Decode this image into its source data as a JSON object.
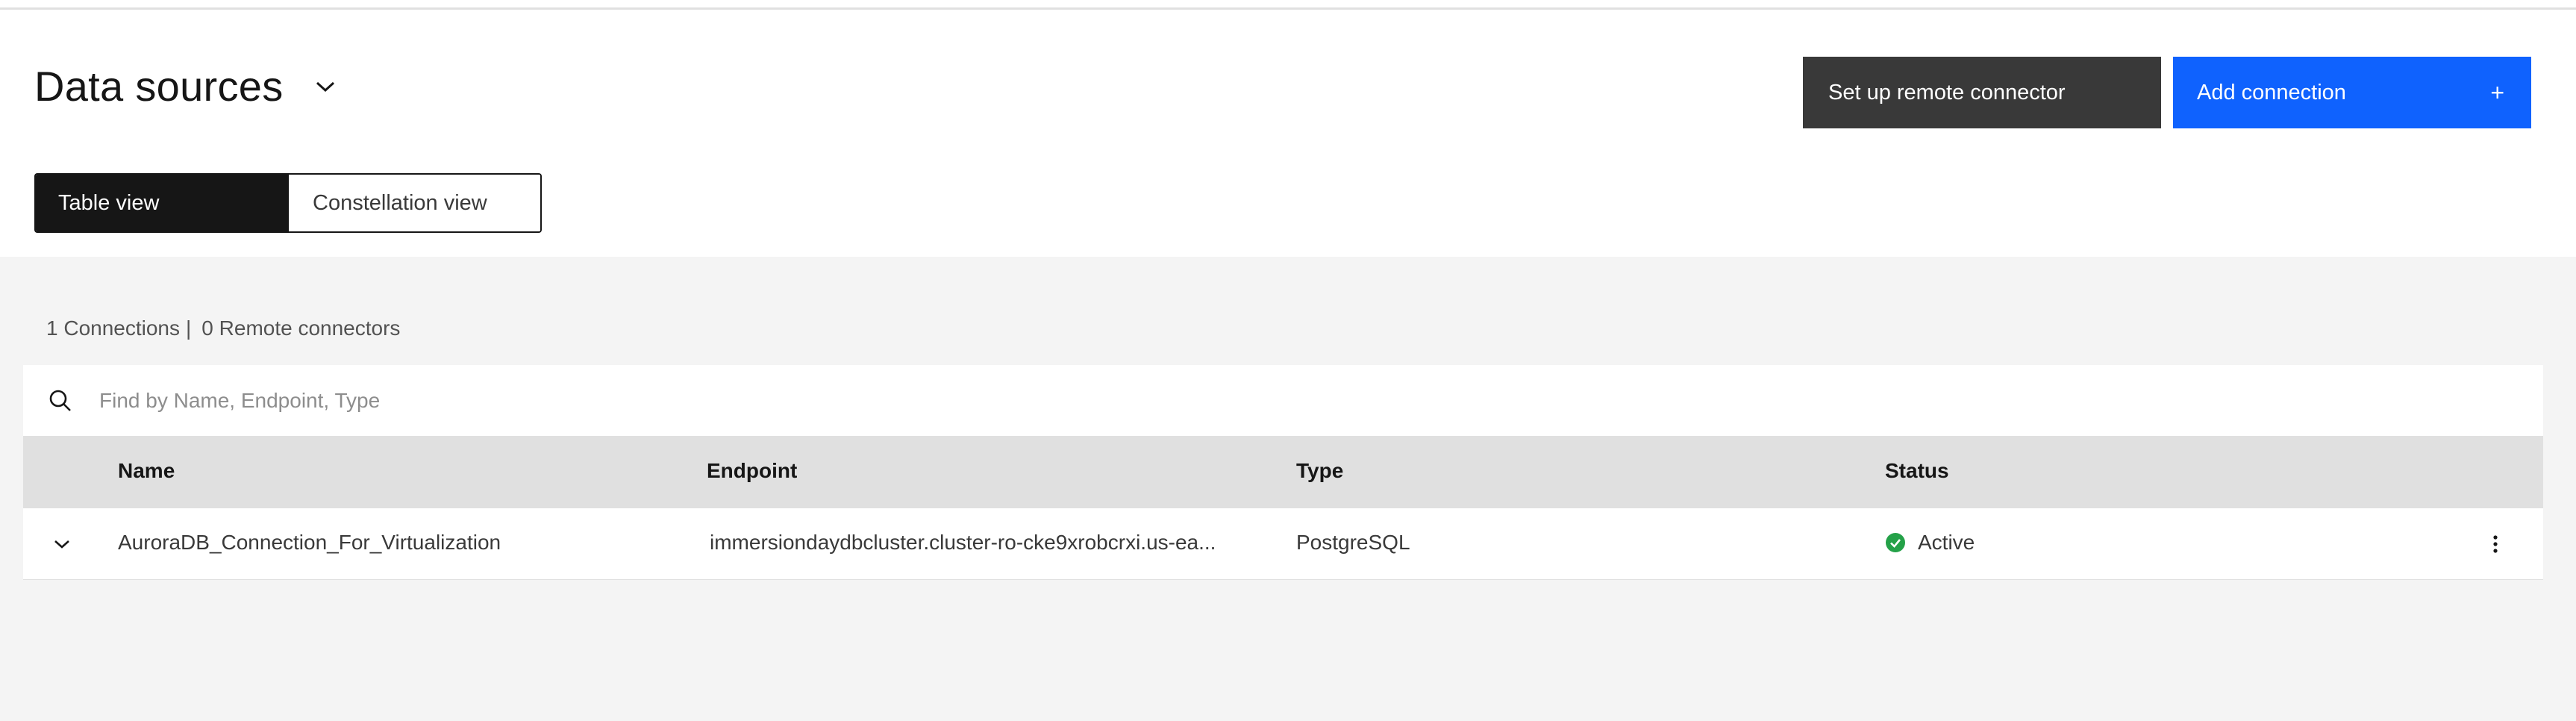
{
  "header": {
    "title": "Data sources",
    "setup_remote_label": "Set up remote connector",
    "add_connection_label": "Add connection",
    "add_icon": "+"
  },
  "view_switch": {
    "options": [
      "Table view",
      "Constellation view"
    ],
    "selected": "Table view"
  },
  "summary": {
    "connections": "1 Connections",
    "separator": "|",
    "remote_connectors": "0 Remote connectors"
  },
  "search": {
    "placeholder": "Find by Name, Endpoint, Type",
    "value": ""
  },
  "table": {
    "columns": [
      "Name",
      "Endpoint",
      "Type",
      "Status"
    ],
    "rows": [
      {
        "name": "AuroraDB_Connection_For_Virtualization",
        "endpoint": "immersiondaydbcluster.cluster-ro-cke9xrobcrxi.us-ea...",
        "type": "PostgreSQL",
        "status": "Active"
      }
    ]
  },
  "colors": {
    "primary_button": "#0f62fe",
    "secondary_button": "#393939",
    "status_active": "#24a148",
    "table_header_bg": "#e0e0e0",
    "page_bg": "#f4f4f4"
  },
  "icons": {
    "title_dropdown": "chevron-down-icon",
    "search": "search-icon",
    "row_expand": "chevron-down-icon",
    "status": "checkmark-filled-icon",
    "row_menu": "overflow-menu-vertical-icon"
  }
}
